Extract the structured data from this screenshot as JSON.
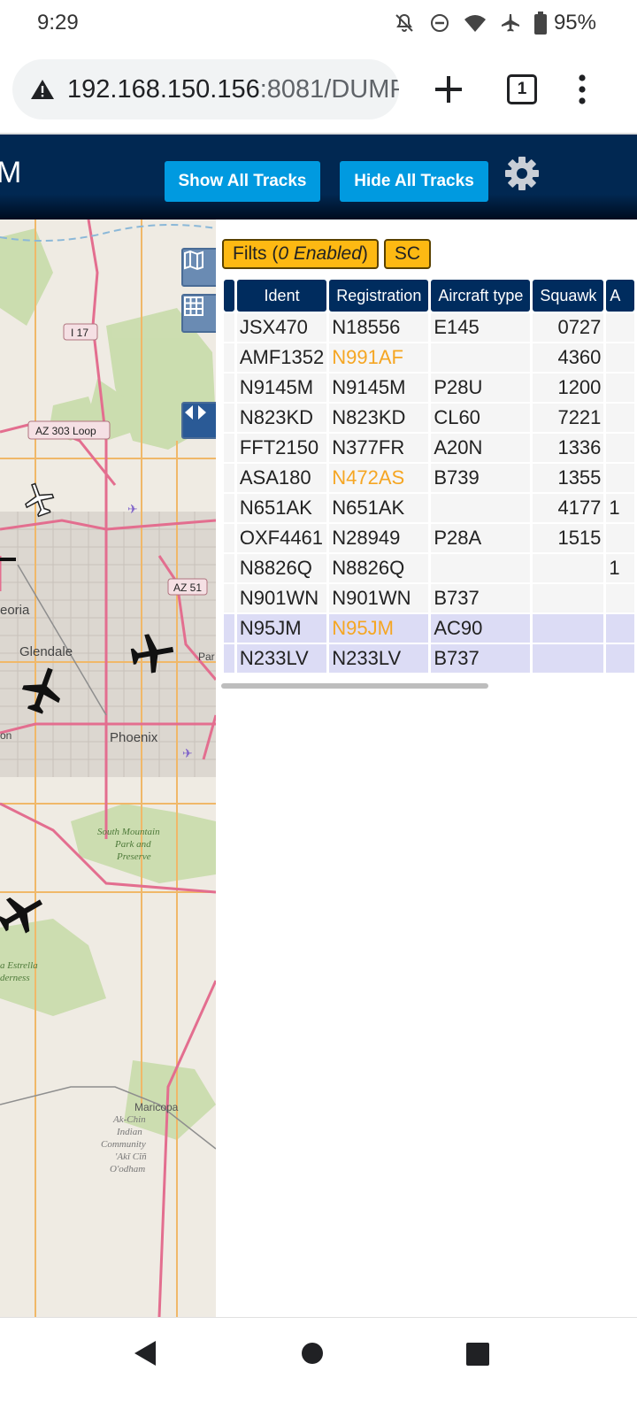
{
  "status_bar": {
    "time": "9:29",
    "icons": [
      "bell-off-icon",
      "do-not-disturb-icon",
      "wifi-icon",
      "airplane-mode-icon",
      "battery-icon"
    ],
    "battery": "95%"
  },
  "browser": {
    "url_host": "192.168.150.156",
    "url_rest": ":8081/DUMP",
    "tab_count": "1"
  },
  "header": {
    "logo_fragment": "M",
    "show_all_tracks": "Show All Tracks",
    "hide_all_tracks": "Hide All Tracks"
  },
  "map": {
    "labels": {
      "i17": "I 17",
      "az303": "AZ 303 Loop",
      "az51": "AZ 51",
      "peoria": "eoria",
      "glendale": "Glendale",
      "phoenix": "Phoenix",
      "par": "Par",
      "on": "on",
      "south_mountain_1": "South Mountain",
      "south_mountain_2": "Park and",
      "south_mountain_3": "Preserve",
      "estrella_1": "a Estrella",
      "estrella_2": "derness",
      "maricopa": "Maricopa",
      "akchin_1": "Ak-Chin",
      "akchin_2": "Indian",
      "akchin_3": "Community",
      "akchin_4": "'Akĭ Cĭñ",
      "akchin_5": "O'odham"
    }
  },
  "filters": {
    "filters_label": "Filts (",
    "filters_enabled": "0 Enabled",
    "filters_close": ")",
    "sc_label": "SC"
  },
  "table": {
    "columns": [
      "",
      "Ident",
      "Registration",
      "Aircraft type",
      "Squawk",
      "A"
    ],
    "rows": [
      {
        "ident": "JSX470",
        "reg": "N18556",
        "type": "E145",
        "squawk": "0727",
        "extra": "",
        "reg_flag": false,
        "selected": false
      },
      {
        "ident": "AMF1352",
        "reg": "N991AF",
        "type": "",
        "squawk": "4360",
        "extra": "",
        "reg_flag": true,
        "selected": false
      },
      {
        "ident": "N9145M",
        "reg": "N9145M",
        "type": "P28U",
        "squawk": "1200",
        "extra": "",
        "reg_flag": false,
        "selected": false
      },
      {
        "ident": "N823KD",
        "reg": "N823KD",
        "type": "CL60",
        "squawk": "7221",
        "extra": "",
        "reg_flag": false,
        "selected": false
      },
      {
        "ident": "FFT2150",
        "reg": "N377FR",
        "type": "A20N",
        "squawk": "1336",
        "extra": "",
        "reg_flag": false,
        "selected": false
      },
      {
        "ident": "ASA180",
        "reg": "N472AS",
        "type": "B739",
        "squawk": "1355",
        "extra": "",
        "reg_flag": true,
        "selected": false
      },
      {
        "ident": "N651AK",
        "reg": "N651AK",
        "type": "",
        "squawk": "4177",
        "extra": "1",
        "reg_flag": false,
        "selected": false
      },
      {
        "ident": "OXF4461",
        "reg": "N28949",
        "type": "P28A",
        "squawk": "1515",
        "extra": "",
        "reg_flag": false,
        "selected": false
      },
      {
        "ident": "N8826Q",
        "reg": "N8826Q",
        "type": "",
        "squawk": "",
        "extra": "1",
        "reg_flag": false,
        "selected": false
      },
      {
        "ident": "N901WN",
        "reg": "N901WN",
        "type": "B737",
        "squawk": "",
        "extra": "",
        "reg_flag": false,
        "selected": false
      },
      {
        "ident": "N95JM",
        "reg": "N95JM",
        "type": "AC90",
        "squawk": "",
        "extra": "",
        "reg_flag": true,
        "selected": true
      },
      {
        "ident": "N233LV",
        "reg": "N233LV",
        "type": "B737",
        "squawk": "",
        "extra": "",
        "reg_flag": false,
        "selected": true
      }
    ]
  },
  "colors": {
    "header_bg": "#012852",
    "button_blue": "#009ae0",
    "filter_yellow": "#fdb913",
    "flag_orange": "#f5a623",
    "selected_row": "#dcdcf5"
  }
}
